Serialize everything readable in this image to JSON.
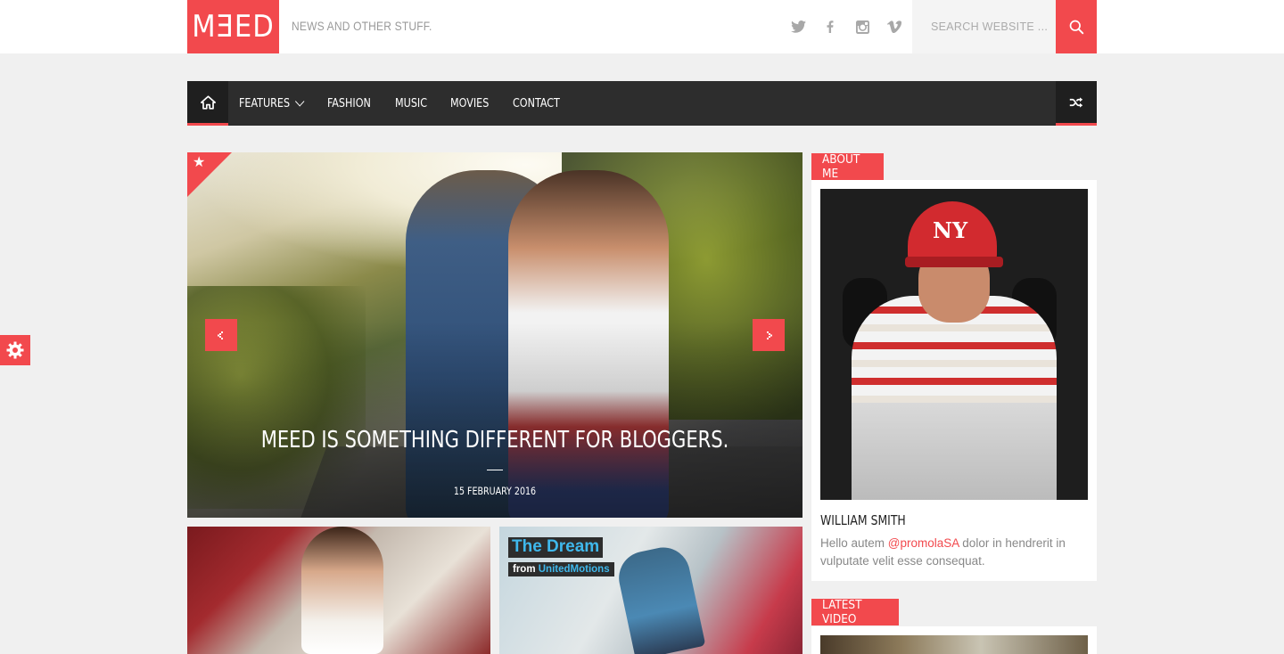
{
  "header": {
    "logo": "MƎED",
    "tagline": "NEWS AND OTHER STUFF.",
    "social": [
      "twitter-icon",
      "facebook-icon",
      "instagram-icon",
      "vimeo-icon"
    ],
    "search_placeholder": "SEARCH WEBSITE ..."
  },
  "nav": {
    "items": [
      {
        "label": "FEATURES",
        "dropdown": true
      },
      {
        "label": "FASHION"
      },
      {
        "label": "MUSIC"
      },
      {
        "label": "MOVIES"
      },
      {
        "label": "CONTACT"
      }
    ]
  },
  "slider": {
    "title": "MEED IS SOMETHING DIFFERENT FOR BLOGGERS.",
    "date": "15 FEBRUARY 2016"
  },
  "thumbs": {
    "video": {
      "title": "The Dream",
      "sub_prefix": "from ",
      "sub_brand": "UnitedMotions"
    }
  },
  "sidebar": {
    "about": {
      "heading": "ABOUT ME",
      "name": "WILLIAM SMITH",
      "text_before": "Hello autem ",
      "handle": "@promolaSA",
      "text_after": " dolor in hendrerit in vulputate velit esse consequat.",
      "cap_logo": "NY"
    },
    "video": {
      "heading": "LATEST VIDEO"
    }
  },
  "colors": {
    "accent": "#f2494d",
    "nav_bg": "#2d2d2d",
    "page_bg": "#f0f0f0"
  }
}
